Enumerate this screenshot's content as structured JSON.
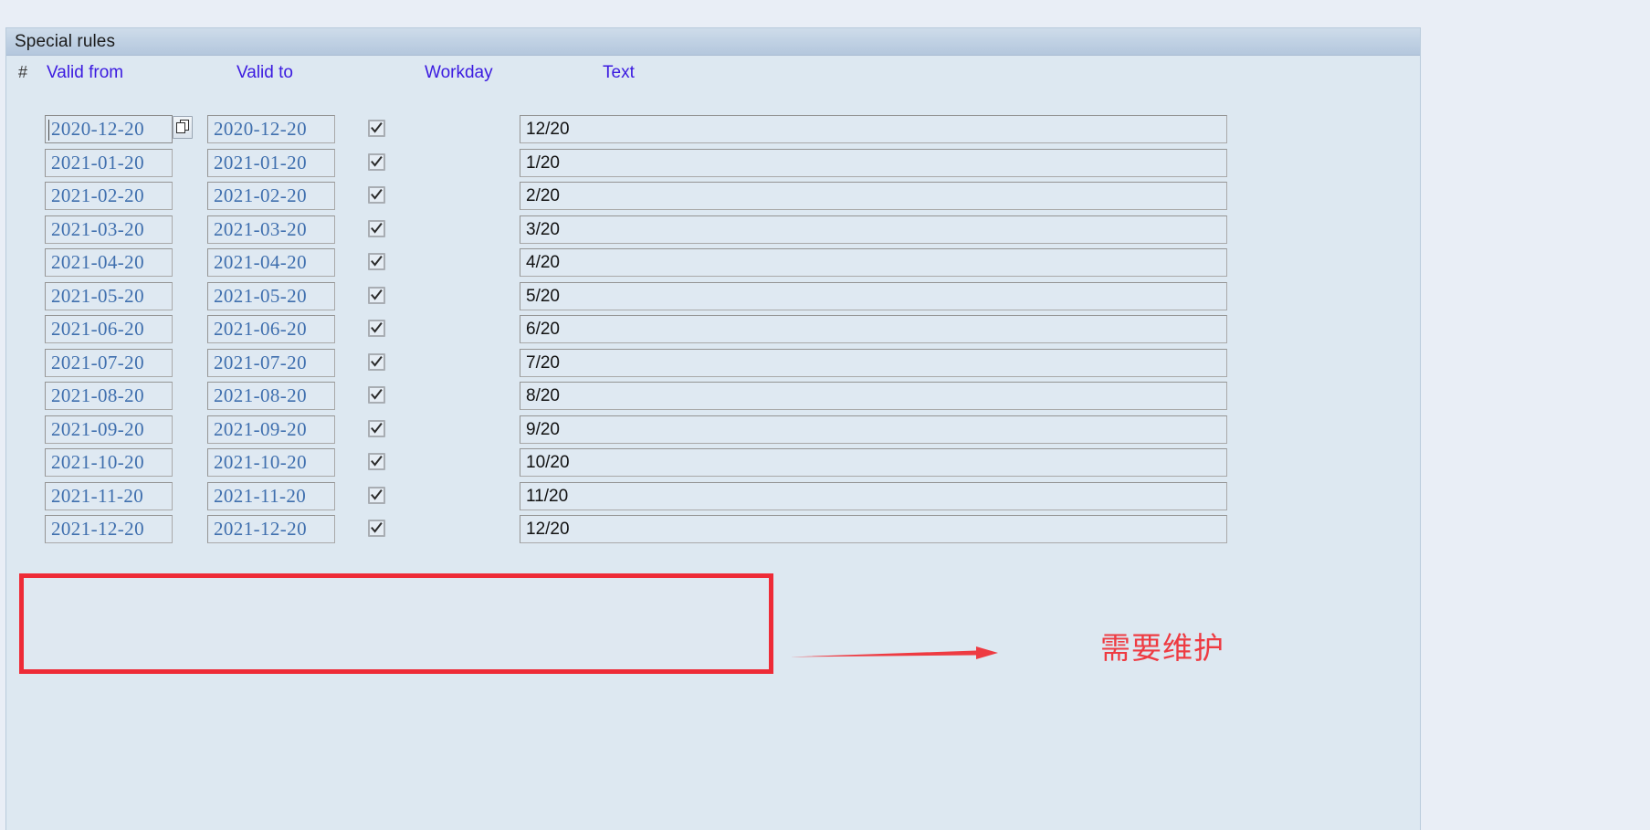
{
  "panel": {
    "title": "Special rules"
  },
  "table": {
    "headers": {
      "index": "#",
      "valid_from": "Valid from",
      "valid_to": "Valid to",
      "workday": "Workday",
      "text": "Text"
    },
    "rows": [
      {
        "valid_from": "2020-12-20",
        "valid_to": "2020-12-20",
        "workday": true,
        "text": "12/20",
        "focused": true,
        "has_picker": true
      },
      {
        "valid_from": "2021-01-20",
        "valid_to": "2021-01-20",
        "workday": true,
        "text": "1/20",
        "focused": false,
        "has_picker": false
      },
      {
        "valid_from": "2021-02-20",
        "valid_to": "2021-02-20",
        "workday": true,
        "text": "2/20",
        "focused": false,
        "has_picker": false
      },
      {
        "valid_from": "2021-03-20",
        "valid_to": "2021-03-20",
        "workday": true,
        "text": "3/20",
        "focused": false,
        "has_picker": false
      },
      {
        "valid_from": "2021-04-20",
        "valid_to": "2021-04-20",
        "workday": true,
        "text": "4/20",
        "focused": false,
        "has_picker": false
      },
      {
        "valid_from": "2021-05-20",
        "valid_to": "2021-05-20",
        "workday": true,
        "text": "5/20",
        "focused": false,
        "has_picker": false
      },
      {
        "valid_from": "2021-06-20",
        "valid_to": "2021-06-20",
        "workday": true,
        "text": "6/20",
        "focused": false,
        "has_picker": false
      },
      {
        "valid_from": "2021-07-20",
        "valid_to": "2021-07-20",
        "workday": true,
        "text": "7/20",
        "focused": false,
        "has_picker": false
      },
      {
        "valid_from": "2021-08-20",
        "valid_to": "2021-08-20",
        "workday": true,
        "text": "8/20",
        "focused": false,
        "has_picker": false
      },
      {
        "valid_from": "2021-09-20",
        "valid_to": "2021-09-20",
        "workday": true,
        "text": "9/20",
        "focused": false,
        "has_picker": false
      },
      {
        "valid_from": "2021-10-20",
        "valid_to": "2021-10-20",
        "workday": true,
        "text": "10/20",
        "focused": false,
        "has_picker": false
      },
      {
        "valid_from": "2021-11-20",
        "valid_to": "2021-11-20",
        "workday": true,
        "text": "11/20",
        "focused": false,
        "has_picker": false
      },
      {
        "valid_from": "2021-12-20",
        "valid_to": "2021-12-20",
        "workday": true,
        "text": "12/20",
        "focused": false,
        "has_picker": false
      }
    ]
  },
  "annotation": {
    "label": "需要维护",
    "color": "#ee3b42",
    "box_color": "#ee2b37"
  },
  "icons": {
    "picker": "copy-pages-icon",
    "check": "checkmark-icon",
    "arrow": "right-arrow-icon"
  },
  "colors": {
    "panel_background": "#dde8f1",
    "page_background": "#e9eef6",
    "title_bar": "#bfd0e3",
    "header_text": "#3b1ae0",
    "date_text": "#3f6fae",
    "field_background": "#dfe9f2"
  }
}
